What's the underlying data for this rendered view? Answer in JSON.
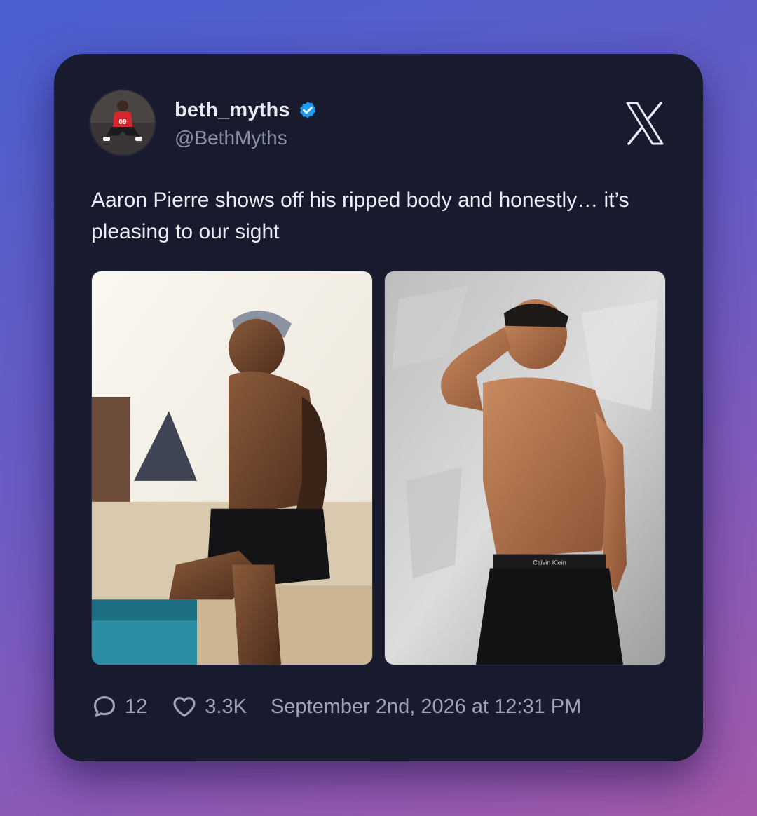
{
  "author": {
    "display_name": "beth_myths",
    "handle": "@BethMyths",
    "verified": true
  },
  "tweet": {
    "text": "Aaron Pierre shows off his ripped body and honestly… it’s pleasing to our sight"
  },
  "stats": {
    "replies": "12",
    "likes": "3.3K",
    "timestamp": "September 2nd, 2026 at 12:31 PM"
  },
  "icons": {
    "platform": "x-logo-icon",
    "verified": "verified-badge-icon",
    "reply": "speech-bubble-icon",
    "like": "heart-icon"
  },
  "colors": {
    "card_background": "#181a2e",
    "verified_badge": "#1d9bf0",
    "text_primary": "#ecebf3",
    "text_secondary": "#8b8fa8"
  }
}
